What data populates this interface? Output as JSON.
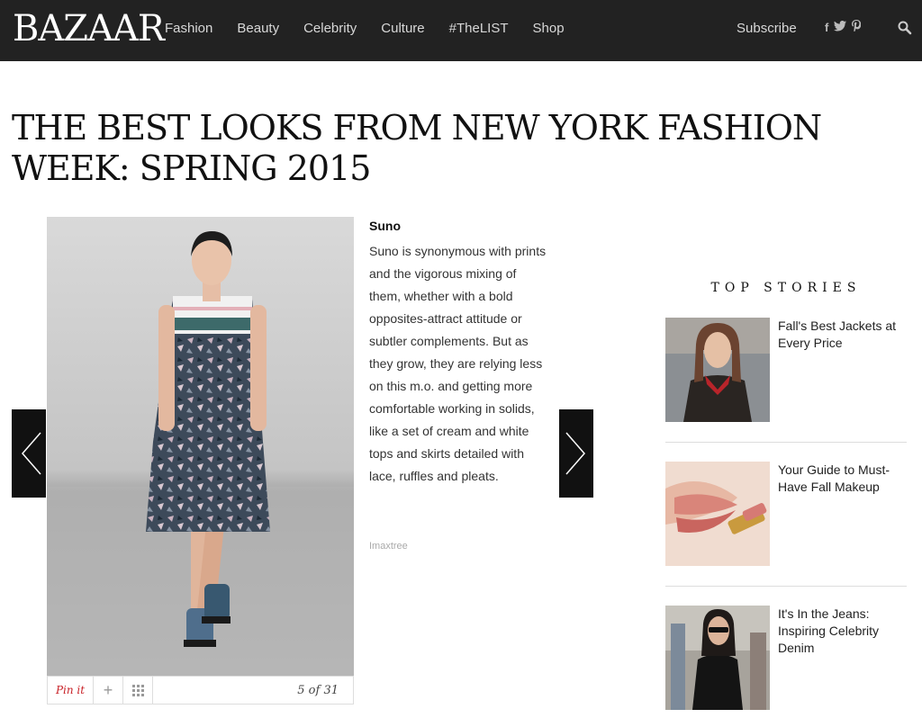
{
  "header": {
    "logo": "BAZAAR",
    "nav": [
      "Fashion",
      "Beauty",
      "Celebrity",
      "Culture",
      "#TheLIST",
      "Shop"
    ],
    "subscribe": "Subscribe",
    "social": [
      "f",
      "t",
      "p"
    ]
  },
  "article": {
    "title": "THE BEST LOOKS FROM NEW YORK FASHION WEEK: SPRING 2015"
  },
  "slide": {
    "title": "Suno",
    "text": "Suno is synonymous with prints and the vigorous mixing of them, whether with a bold opposites-attract attitude or subtler complements. But as they grow, they are relying less on this m.o. and getting more comfortable working in solids, like a set of cream and white tops and skirts detailed with lace, ruffles and pleats.",
    "credit": "Imaxtree",
    "pin_label": "Pin it",
    "counter": "5 of 31"
  },
  "top_stories": {
    "heading": "TOP STORIES",
    "items": [
      {
        "title": "Fall's Best Jackets at Every Price"
      },
      {
        "title": "Your Guide to Must-Have Fall Makeup"
      },
      {
        "title": "It's In the Jeans: Inspiring Celebrity Denim"
      }
    ]
  },
  "colors": {
    "header_bg": "#222222",
    "pin_red": "#c92228"
  }
}
